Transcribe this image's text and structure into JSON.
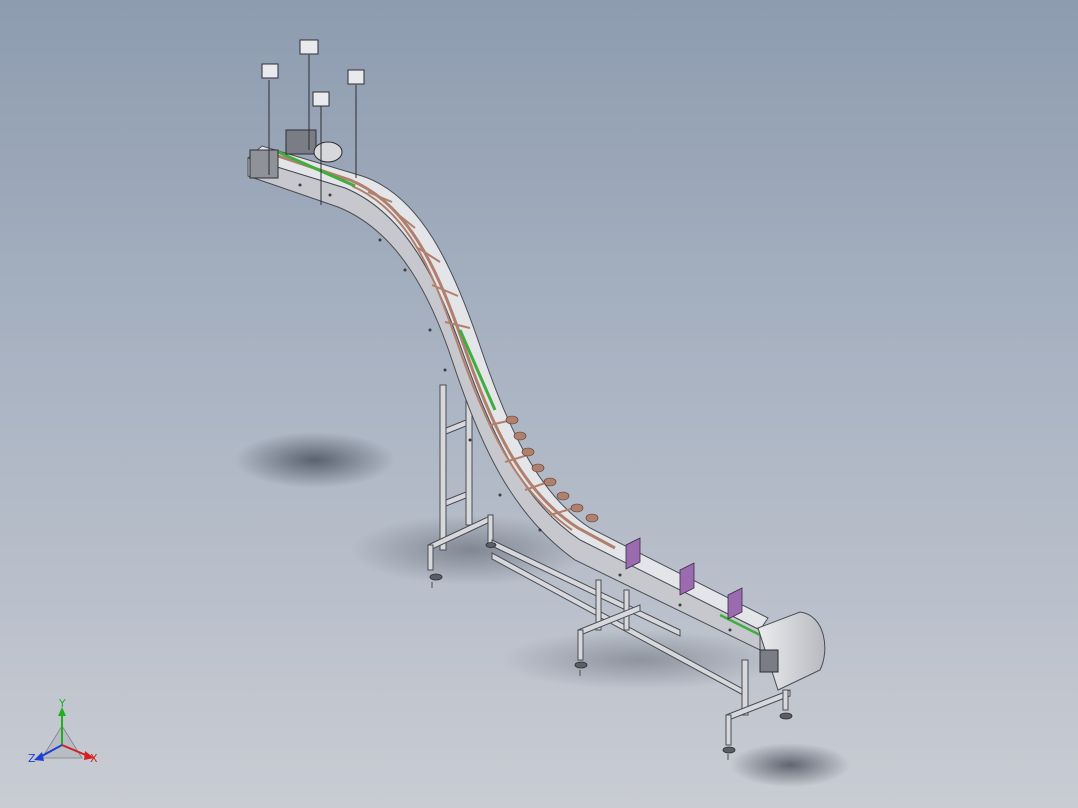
{
  "viewport": {
    "background_top": "#8e9cb0",
    "background_bottom": "#c9ccd3"
  },
  "model": {
    "frame_color": "#d6d8dc",
    "frame_edge": "#4a4d55",
    "chain_color": "#b0806e",
    "guide_rail_color": "#3fae3f",
    "bracket_color": "#9b6bb0",
    "motor_color": "#7a7d85",
    "shadow_color": "#5e6673"
  },
  "triad": {
    "x_label": "X",
    "y_label": "Y",
    "z_label": "Z",
    "x_color": "#d42020",
    "y_color": "#20b020",
    "z_color": "#2040d0"
  }
}
